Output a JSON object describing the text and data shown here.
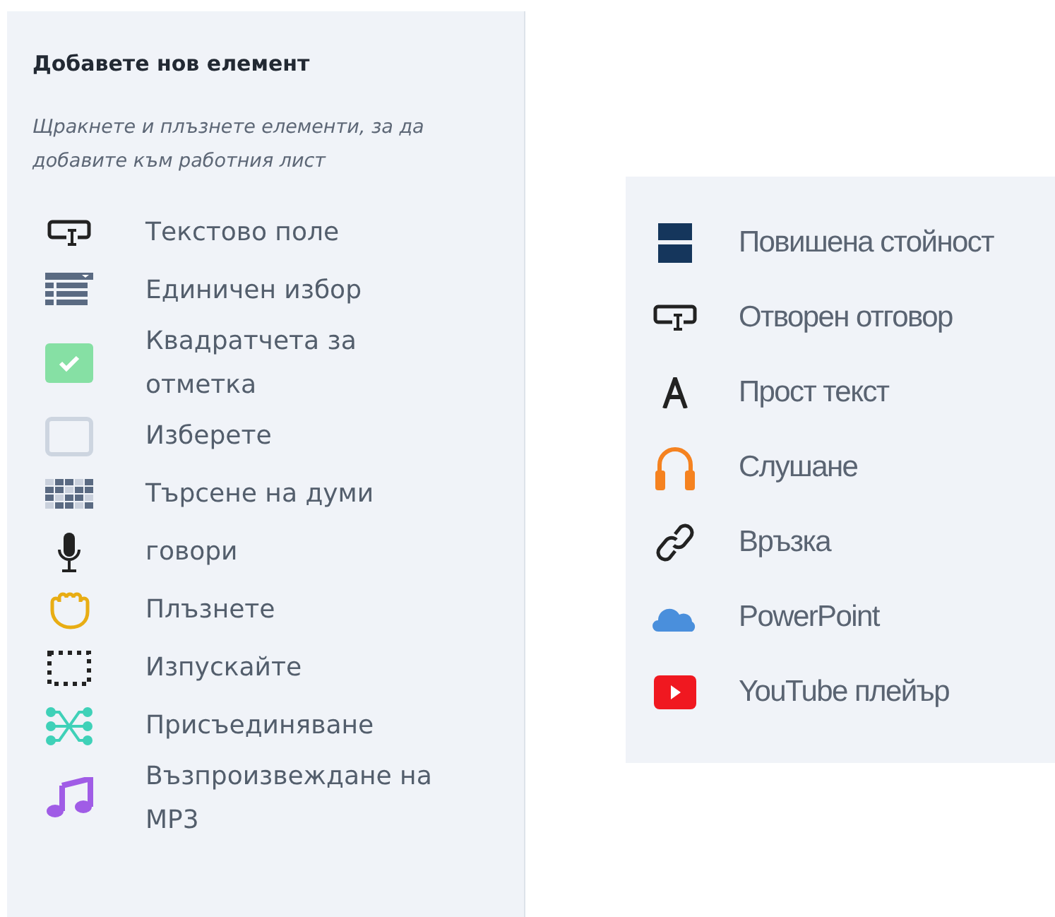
{
  "left_panel": {
    "title": "Добавете нов елемент",
    "hint": "Щракнете и плъзнете елементи, за да добавите към работния лист",
    "items": [
      {
        "kind": "textbox",
        "label": "Текстово поле"
      },
      {
        "kind": "list",
        "label": "Единичен избор"
      },
      {
        "kind": "checkbox",
        "label": "Квадратчета за отметка"
      },
      {
        "kind": "select",
        "label": "Изберете"
      },
      {
        "kind": "grid",
        "label": "Търсене на думи"
      },
      {
        "kind": "mic",
        "label": "говори"
      },
      {
        "kind": "hand",
        "label": "Плъзнете"
      },
      {
        "kind": "dotted",
        "label": "Изпускайте"
      },
      {
        "kind": "join",
        "label": "Присъединяване"
      },
      {
        "kind": "music",
        "label": "Възпроизвеждане на MP3"
      }
    ]
  },
  "right_panel": {
    "items": [
      {
        "kind": "bars",
        "label": "Повишена стойност"
      },
      {
        "kind": "textbox",
        "label": "Отворен отговор"
      },
      {
        "kind": "letter",
        "label": "Прост текст"
      },
      {
        "kind": "headphones",
        "label": "Слушане"
      },
      {
        "kind": "link",
        "label": "Връзка"
      },
      {
        "kind": "cloud",
        "label": "PowerPoint"
      },
      {
        "kind": "youtube",
        "label": "YouTube плейър"
      }
    ]
  }
}
